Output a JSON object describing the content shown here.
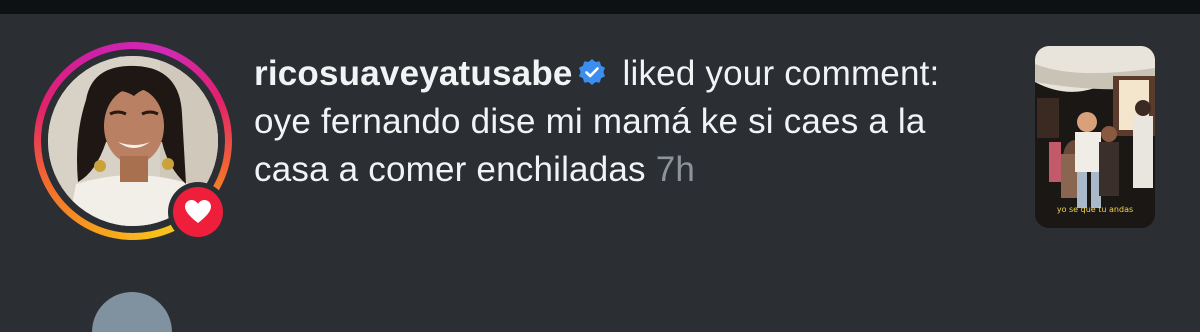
{
  "notification": {
    "username": "ricosuaveyatusabe",
    "action_text": " liked your comment: oye fernando dise mi mamá ke si caes a la casa a comer enchiladas ",
    "time": "7h",
    "badge_icon": "heart-icon",
    "verified_icon": "verified-badge-icon"
  },
  "thumbnail": {
    "caption": "yo se que tu andas"
  },
  "colors": {
    "background": "#2b2f33",
    "text": "#f1f3f5",
    "muted": "#8d9399",
    "verified": "#3b8ef0",
    "heart": "#ef1f3c"
  }
}
